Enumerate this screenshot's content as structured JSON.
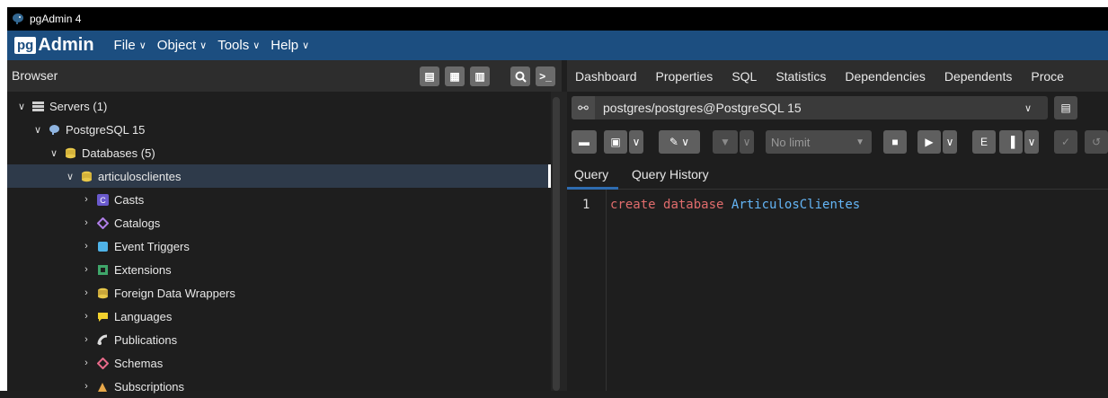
{
  "window": {
    "title": "pgAdmin 4"
  },
  "menubar": {
    "brand_prefix": "pg",
    "brand_suffix": "Admin",
    "items": [
      {
        "label": "File"
      },
      {
        "label": "Object"
      },
      {
        "label": "Tools"
      },
      {
        "label": "Help"
      }
    ]
  },
  "browser": {
    "title": "Browser",
    "tree": [
      {
        "label": "Servers (1)",
        "level": 0,
        "expanded": true,
        "icon": "servers-icon"
      },
      {
        "label": "PostgreSQL 15",
        "level": 1,
        "expanded": true,
        "icon": "elephant-icon"
      },
      {
        "label": "Databases (5)",
        "level": 2,
        "expanded": true,
        "icon": "databases-icon"
      },
      {
        "label": "articulosclientes",
        "level": 3,
        "expanded": true,
        "icon": "database-icon",
        "selected": true
      },
      {
        "label": "Casts",
        "level": 4,
        "expanded": false,
        "icon": "casts-icon"
      },
      {
        "label": "Catalogs",
        "level": 4,
        "expanded": false,
        "icon": "catalogs-icon"
      },
      {
        "label": "Event Triggers",
        "level": 4,
        "expanded": false,
        "icon": "event-triggers-icon"
      },
      {
        "label": "Extensions",
        "level": 4,
        "expanded": false,
        "icon": "extensions-icon"
      },
      {
        "label": "Foreign Data Wrappers",
        "level": 4,
        "expanded": false,
        "icon": "foreign-data-wrappers-icon"
      },
      {
        "label": "Languages",
        "level": 4,
        "expanded": false,
        "icon": "languages-icon"
      },
      {
        "label": "Publications",
        "level": 4,
        "expanded": false,
        "icon": "publications-icon"
      },
      {
        "label": "Schemas",
        "level": 4,
        "expanded": false,
        "icon": "schemas-icon"
      },
      {
        "label": "Subscriptions",
        "level": 4,
        "expanded": false,
        "icon": "subscriptions-icon"
      }
    ]
  },
  "tabs": [
    {
      "label": "Dashboard"
    },
    {
      "label": "Properties"
    },
    {
      "label": "SQL"
    },
    {
      "label": "Statistics"
    },
    {
      "label": "Dependencies"
    },
    {
      "label": "Dependents"
    },
    {
      "label": "Proce"
    }
  ],
  "connection": {
    "value": "postgres/postgres@PostgreSQL 15"
  },
  "toolbar": {
    "limit_value": "No limit"
  },
  "query_tabs": {
    "query": "Query",
    "history": "Query History"
  },
  "editor": {
    "line_number": "1",
    "keyword_1": "create",
    "keyword_2": "database",
    "identifier": "ArticulosClientes"
  },
  "colors": {
    "menubar_bg": "#1c4e80",
    "keyword": "#e06c6c",
    "identifier": "#64b5f6",
    "selected_row": "#2e3a4a"
  }
}
